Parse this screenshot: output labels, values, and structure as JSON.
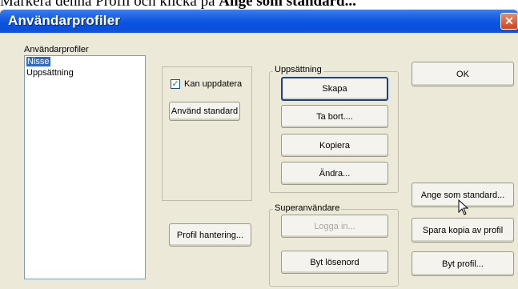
{
  "caption": {
    "prefix": "Markera denna Profil och klicka på ",
    "bold": "Ange som standard..."
  },
  "window": {
    "title": "Användarprofiler"
  },
  "profiles": {
    "label": "Användarprofiler",
    "items": [
      {
        "label": "Nisse",
        "selected": true
      },
      {
        "label": "Uppsättning",
        "selected": false
      }
    ]
  },
  "left_panel": {
    "checkbox_label": "Kan uppdatera",
    "checkbox_checked": true,
    "use_default_button": "Använd standard"
  },
  "profile_management_button": "Profil hantering...",
  "setup_group": {
    "legend": "Uppsättning",
    "create_button": "Skapa",
    "delete_button": "Ta bort....",
    "copy_button": "Kopiera",
    "edit_button": "Ändra..."
  },
  "superuser_group": {
    "legend": "Superanvändare",
    "login_button": "Logga in...",
    "change_password_button": "Byt lösenord"
  },
  "right_buttons": {
    "ok": "OK",
    "set_default": "Ange som standard...",
    "save_copy": "Spara kopia av profil",
    "switch_profile": "Byt profil..."
  },
  "colors": {
    "titlebar": "#0a54e2",
    "dialog_bg": "#ece9d8",
    "selection": "#316ac5",
    "close": "#d6411c"
  },
  "icons": {
    "close": "close-icon",
    "checkbox": "checkmark-icon",
    "pointer": "mouse-pointer-icon"
  }
}
